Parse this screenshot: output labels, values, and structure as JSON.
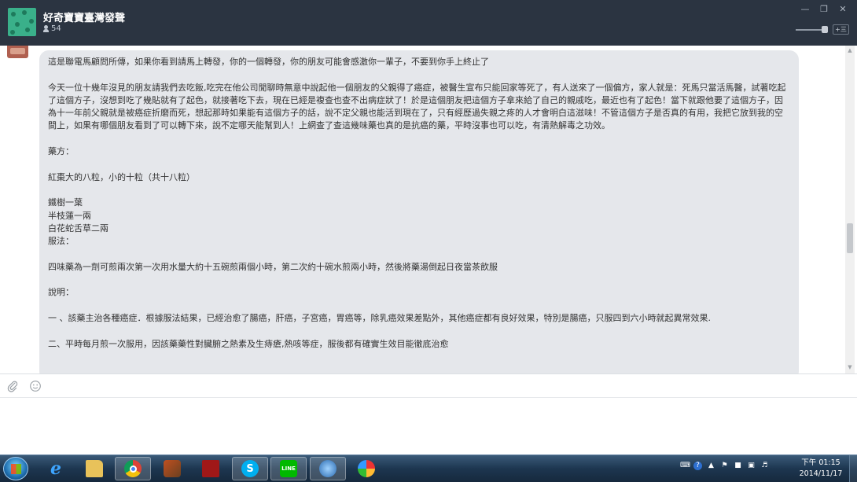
{
  "header": {
    "group_title": "好奇寶寶臺灣發聲",
    "member_count": "54",
    "minimize_icon": "minimize-icon",
    "restore_icon": "restore-icon",
    "close_icon": "close-icon",
    "zoom_button": "+三"
  },
  "message": {
    "lines": [
      "這是聯電馬顧問所傳，如果你看到請馬上轉發，你的一個轉發，你的朋友可能會感激你一輩子，不要到你手上終止了",
      "今天一位十幾年沒見的朋友請我們去吃飯,吃完在他公司閒聊時無意中說起他一個朋友的父親得了癌症，被醫生宣布只能回家等死了，有人送來了一個偏方，家人就是：死馬只當活馬醫，試著吃起了這個方子，沒想到吃了幾貼就有了起色，就接著吃下去，現在已經是複查也查不出病症狀了！於是這個朋友把這個方子拿來給了自己的親戚吃，最近也有了起色！當下就跟他要了這個方子，因為十一年前父親就是被癌症折磨而死，想起那時如果能有這個方子的話，說不定父親也能活到現在了，只有經歷過失親之疼的人才會明白這滋味！不管這個方子是否真的有用，我把它放到我的空間上，如果有哪個朋友看到了可以轉下來，說不定哪天能幫到人！上網查了查這幾味藥也真的是抗癌的藥，平時沒事也可以吃，有清熱解毒之功效。",
      "藥方：",
      "紅棗大的八粒，小的十粒（共十八粒）",
      "鐵樹一葉",
      "半枝蓮一兩",
      "白花蛇舌草二兩",
      "服法：",
      "四味藥為一劑可煎兩次第一次用水量大約十五碗煎兩個小時，第二次約十碗水煎兩小時，然後將藥湯倒起日夜當茶飲服",
      "說明：",
      "一 、該藥主治各種癌症．根據服法結果，已經治愈了腸癌，肝癌，子宮癌，胃癌等，除乳癌效果差點外，其他癌症都有良好效果，特別是腸癌，只服四到六小時就起異常效果.",
      "二、平時每月煎一次服用，因該藥藥性對臟腑之熱素及生痔瘡,熱咳等症，服後都有確實生效目能徹底治愈"
    ]
  },
  "input": {
    "attach_icon": "paperclip-icon",
    "emoji_icon": "smiley-icon",
    "text": ""
  },
  "taskbar": {
    "apps": [
      "internet-explorer",
      "file-explorer",
      "chrome",
      "paint-tools",
      "document-app",
      "skype",
      "line",
      "network-app",
      "paint"
    ],
    "line_label": "LINE",
    "clock_time": "下午 01:15",
    "clock_date": "2014/11/17"
  },
  "colors": {
    "header_bg": "#2b3441",
    "bubble_bg": "#e5e7eb",
    "line_green": "#00b900",
    "skype_blue": "#00aff0"
  }
}
